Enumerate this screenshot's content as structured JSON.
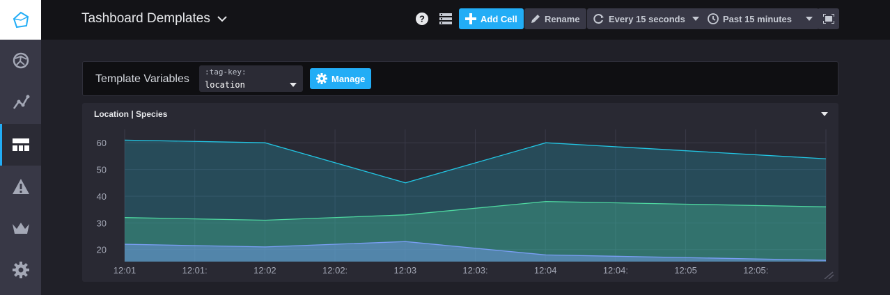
{
  "sidebar": {
    "items": [
      {
        "name": "logo-icon"
      },
      {
        "name": "host-list-icon"
      },
      {
        "name": "data-explorer-icon"
      },
      {
        "name": "dashboards-icon",
        "active": true
      },
      {
        "name": "alerts-icon"
      },
      {
        "name": "admin-icon"
      },
      {
        "name": "configuration-icon"
      }
    ]
  },
  "header": {
    "title": "Tashboard Demplates",
    "add_cell_label": "Add Cell",
    "rename_label": "Rename",
    "refresh_label": "Every 15 seconds",
    "timerange_label": "Past 15 minutes"
  },
  "template_variables": {
    "label": "Template Variables",
    "key": ":tag-key:",
    "value": "location",
    "manage_label": "Manage"
  },
  "cell": {
    "title": "Location | Species"
  },
  "colors": {
    "accent": "#22adf6",
    "series1": "#22c6e4",
    "series2": "#4ed8a0",
    "series3": "#7a9ef5"
  },
  "chart_data": {
    "type": "area",
    "x": [
      "12:01",
      "12:02",
      "12:03",
      "12:04",
      "12:05",
      "12:05:40"
    ],
    "tick_labels": [
      "12:01",
      "12:01:",
      "12:02",
      "12:02:",
      "12:03",
      "12:03:",
      "12:04",
      "12:04:",
      "12:05",
      "12:05:"
    ],
    "series": [
      {
        "values": [
          61,
          60,
          45,
          60,
          57,
          54
        ]
      },
      {
        "values": [
          32,
          31,
          33,
          38,
          37,
          36
        ]
      },
      {
        "values": [
          22,
          21,
          23,
          18,
          17,
          16
        ]
      }
    ],
    "yticks": [
      20,
      30,
      40,
      50,
      60
    ],
    "ylim": [
      15.5,
      65
    ],
    "grid": true
  }
}
